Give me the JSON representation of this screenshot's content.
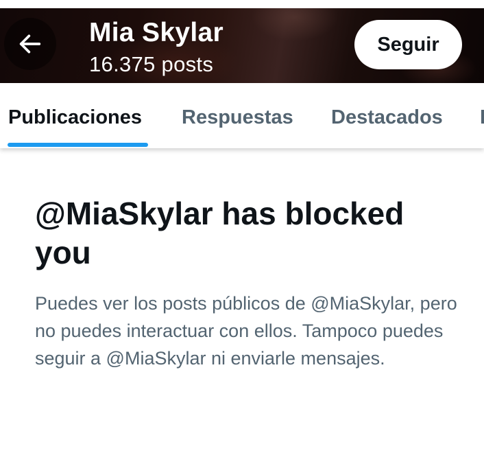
{
  "header": {
    "back_icon": "arrow-left-icon",
    "name": "Mia Skylar",
    "post_count": "16.375 posts",
    "follow_label": "Seguir"
  },
  "tabs": [
    {
      "label": "Publicaciones",
      "active": true
    },
    {
      "label": "Respuestas",
      "active": false
    },
    {
      "label": "Destacados",
      "active": false
    },
    {
      "label": "I",
      "active": false
    }
  ],
  "blocked": {
    "title": "@MiaSkylar has blocked you",
    "description": "Puedes ver los posts públicos de @MiaSkylar, pero no puedes interactuar con ellos. Tampoco puedes seguir a @MiaSkylar ni enviarle mensajes."
  },
  "colors": {
    "accent": "#1d9bf0",
    "text_primary": "#0f1419",
    "text_secondary": "#536471"
  }
}
